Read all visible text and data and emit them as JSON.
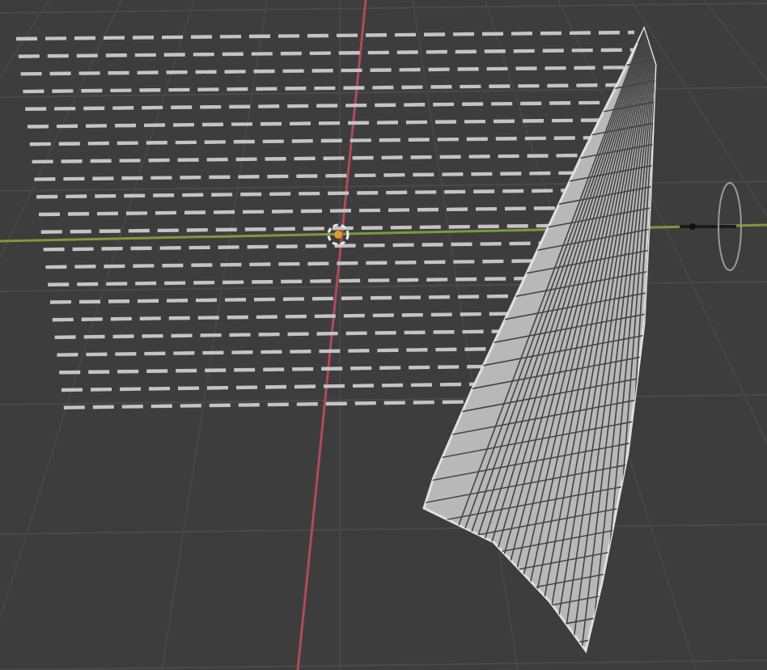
{
  "viewport": {
    "objects": [
      {
        "kind": "floor-grid"
      },
      {
        "kind": "axes"
      },
      {
        "kind": "arrow-field"
      },
      {
        "kind": "origin-cursor"
      },
      {
        "kind": "wind-emitter"
      },
      {
        "kind": "cloth"
      }
    ]
  }
}
